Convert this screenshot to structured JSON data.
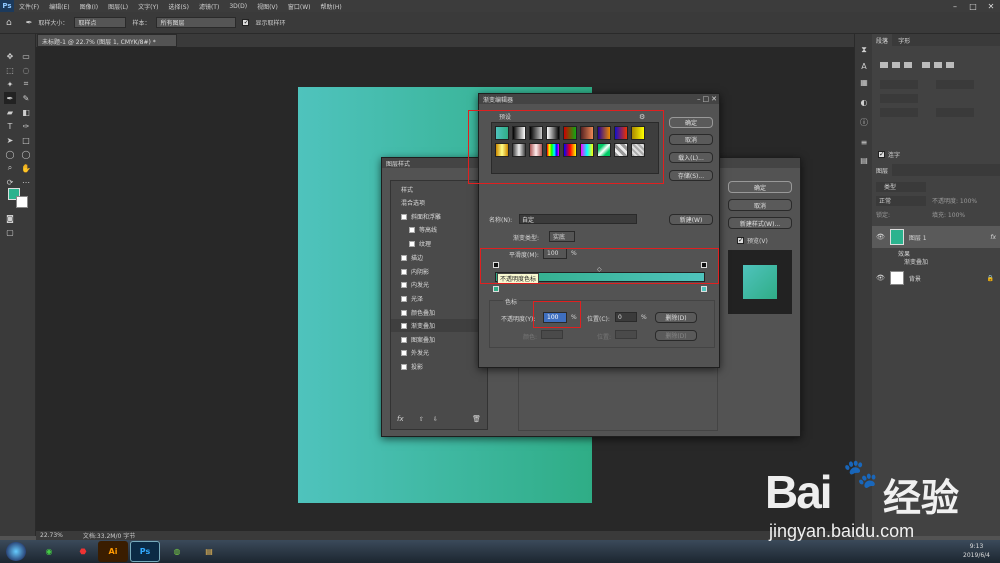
{
  "menu": [
    "文件(F)",
    "编辑(E)",
    "图像(I)",
    "图层(L)",
    "文字(Y)",
    "选择(S)",
    "滤镜(T)",
    "3D(D)",
    "视图(V)",
    "窗口(W)",
    "帮助(H)"
  ],
  "options": {
    "sample_size_label": "取样大小：",
    "sample_size_value": "取样点",
    "sample_label": "样本：",
    "sample_value": "所有图层",
    "show_ring_label": "显示取样环"
  },
  "doc_tab": "未标题-1 @ 22.7% (图层 1, CMYK/8#) *",
  "status": {
    "zoom": "22.73%",
    "doc": "文档:33.2M/0 字节"
  },
  "right_panel": {
    "tabs": [
      "段落",
      "字形"
    ],
    "layers_tab": "图层",
    "kind": "类型",
    "mode": "正常",
    "opacity_label": "不透明度: 100%",
    "fill_label": "填充: 100%",
    "lock_label": "锁定:",
    "layer1": "图层 1",
    "effects": "效果",
    "effect_item": "渐变叠加",
    "bg_layer": "背景",
    "hyphen_label": "连字"
  },
  "layer_style": {
    "title": "图层样式",
    "header": "样式",
    "blend": "混合选项",
    "items": [
      "斜面和浮雕",
      "等高线",
      "纹理",
      "描边",
      "内阴影",
      "内发光",
      "光泽",
      "颜色叠加",
      "渐变叠加",
      "图案叠加",
      "外发光",
      "投影"
    ],
    "ok": "确定",
    "cancel": "取消",
    "new_style": "新建样式(W)...",
    "preview": "预览(V)"
  },
  "gradient_editor": {
    "title": "渐变编辑器",
    "presets_label": "预设",
    "ok": "确定",
    "cancel": "取消",
    "load": "载入(L)...",
    "save": "存储(S)...",
    "name_label": "名称(N):",
    "name_value": "自定",
    "new_btn": "新建(W)",
    "type_label": "渐变类型:",
    "type_value": "实底",
    "smooth_label": "平滑度(M):",
    "smooth_value": "100",
    "pct": "%",
    "tooltip": "不透明度色标",
    "stops_label": "色标",
    "opacity_label": "不透明度(Y):",
    "opacity_value": "100",
    "location_label": "位置(C):",
    "location_value": "0",
    "delete_btn": "删除(D)",
    "color_label": "颜色:",
    "location2_label": "位置:",
    "delete2_btn": "删除(D)"
  },
  "taskbar": {
    "time": "9:13",
    "date": "2019/6/4"
  },
  "watermark": {
    "brand": "Bai",
    "brand2": "经验",
    "url": "jingyan.baidu.com"
  },
  "colors": {
    "grad_start": "#4fc3bd",
    "grad_end": "#2fad86",
    "accent_red": "#e02020"
  }
}
